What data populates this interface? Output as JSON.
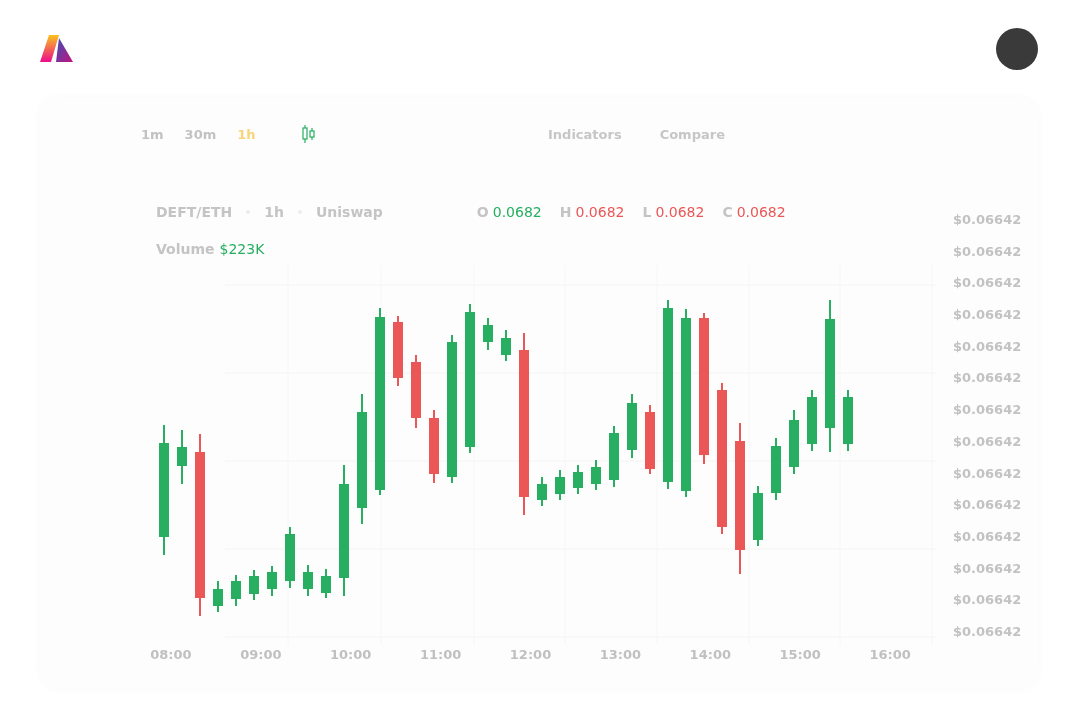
{
  "toolbar": {
    "intervals": [
      {
        "label": "1m",
        "selected": false
      },
      {
        "label": "30m",
        "selected": false
      },
      {
        "label": "1h",
        "selected": true
      }
    ],
    "buttons": [
      "Indicators",
      "Compare"
    ]
  },
  "legend": {
    "pair": "DEFT/ETH",
    "interval": "1h",
    "exchange": "Uniswap",
    "ohlc": [
      {
        "label": "O",
        "value": "0.0682",
        "color": "#27ae60"
      },
      {
        "label": "H",
        "value": "0.0682",
        "color": "#eb5757"
      },
      {
        "label": "L",
        "value": "0.0682",
        "color": "#eb5757"
      },
      {
        "label": "C",
        "value": "0.0682",
        "color": "#eb5757"
      }
    ],
    "volume": {
      "label": "Volume",
      "value": "$223K",
      "color": "#27ae60"
    }
  },
  "price_axis": [
    "$0.06642",
    "$0.06642",
    "$0.06642",
    "$0.06642",
    "$0.06642",
    "$0.06642",
    "$0.06642",
    "$0.06642",
    "$0.06642",
    "$0.06642",
    "$0.06642",
    "$0.06642",
    "$0.06642",
    "$0.06642"
  ],
  "time_axis": [
    "08:00",
    "09:00",
    "10:00",
    "11:00",
    "12:00",
    "13:00",
    "14:00",
    "15:00",
    "16:00"
  ]
}
